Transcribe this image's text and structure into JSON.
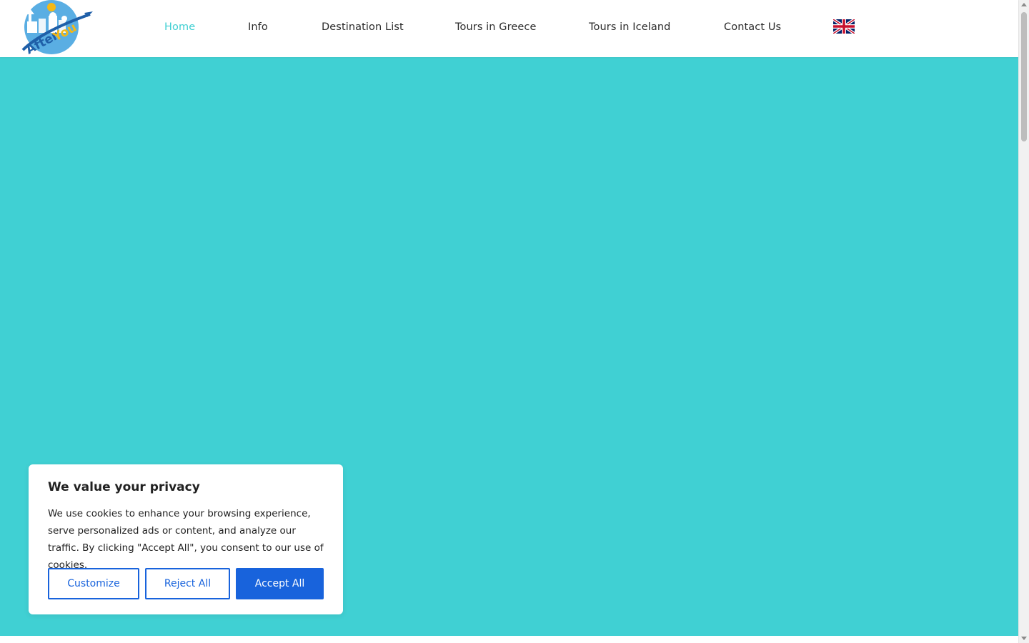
{
  "brand": {
    "logo_primary": "After",
    "logo_accent": "You"
  },
  "nav": {
    "items": [
      {
        "label": "Home",
        "active": true
      },
      {
        "label": "Info",
        "active": false
      },
      {
        "label": "Destination List",
        "active": false
      },
      {
        "label": "Tours in Greece",
        "active": false
      },
      {
        "label": "Tours in Iceland",
        "active": false
      },
      {
        "label": "Contact Us",
        "active": false
      }
    ],
    "language_icon": "uk-flag-icon"
  },
  "colors": {
    "accent": "#3fcfd2",
    "hero_background": "#40d0d3",
    "nav_text": "#2b2b2b",
    "cookie_button_blue": "#1863dc",
    "logo_blue": "#1f5fa8",
    "logo_yellow": "#f5b814"
  },
  "cookie_banner": {
    "title": "We value your privacy",
    "text": "We use cookies to enhance your browsing experience, serve personalized ads or content, and analyze our traffic. By clicking \"Accept All\", you consent to our use of cookies.",
    "customize_label": "Customize",
    "reject_label": "Reject All",
    "accept_label": "Accept All"
  }
}
